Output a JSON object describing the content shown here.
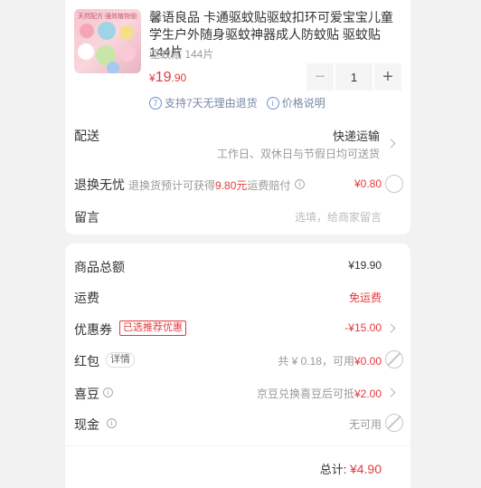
{
  "product": {
    "thumbnail_text": "天然配方 强效植物驱蚊",
    "title": "馨语良品 卡通驱蚊贴驱蚊扣环可爱宝宝儿童学生户外随身驱蚊神器成人防蚊贴 驱蚊贴 144片",
    "spec": "驱蚊贴 144片",
    "price_symbol": "¥",
    "price_int": "19",
    "price_dec": ".90",
    "quantity": "1",
    "minus_symbol": "−",
    "plus_symbol": "+",
    "return_badge_num": "7",
    "return_policy": "支持7天无理由退货",
    "price_note": "价格说明"
  },
  "delivery": {
    "label": "配送",
    "method": "快递运输",
    "detail": "工作日、双休日与节假日均可送货"
  },
  "return_insurance": {
    "label": "退换无忧",
    "desc_prefix": "退换货预计可获得",
    "desc_amount": "9.80元",
    "desc_suffix": "运费赔付",
    "price": "¥0.80"
  },
  "message": {
    "label": "留言",
    "placeholder": "选填，给商家留言"
  },
  "summary": {
    "goods_total_label": "商品总额",
    "goods_total_value": "¥19.90",
    "shipping_label": "运费",
    "shipping_value": "免运费",
    "coupon_label": "优惠券",
    "coupon_tag": "已选推荐优惠",
    "coupon_value": "-¥15.00",
    "redpacket_label": "红包",
    "redpacket_detail_tag": "详情",
    "redpacket_info": "共 ¥ 0.18，可用",
    "redpacket_value": "¥0.00",
    "beans_label": "喜豆",
    "beans_info": "京豆兑换喜豆后可抵",
    "beans_value": "¥2.00",
    "cash_label": "现金",
    "cash_info": "无可用",
    "total_label": "总计:",
    "total_value": "¥4.90"
  }
}
